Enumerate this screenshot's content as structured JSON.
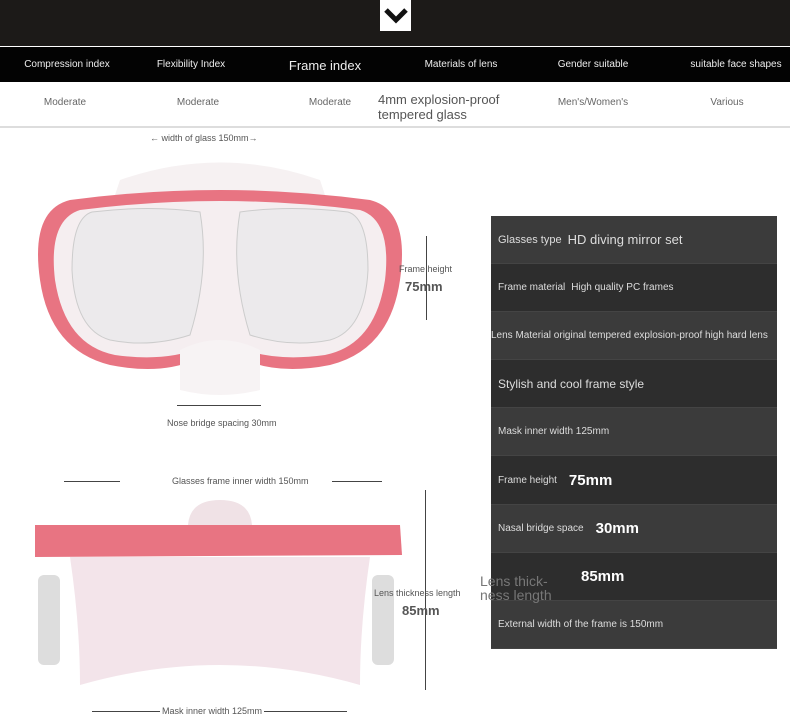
{
  "header": {
    "columns": [
      "Compression index",
      "Flexibility Index",
      "Frame index",
      "Materials of lens",
      "Gender suitable",
      "suitable face shapes"
    ],
    "values": [
      "Moderate",
      "Moderate",
      "Moderate",
      "4mm explosion-proof tempered glass",
      "Men's/Women's",
      "Various"
    ]
  },
  "diagram1": {
    "width_label": "← width of glass 150mm→",
    "height_label": "Frame height",
    "height_value": "75mm",
    "nose_label": "Nose bridge spacing 30mm"
  },
  "diagram2": {
    "width_label": "Glasses frame inner width 150mm",
    "thickness_label": "Lens thickness length",
    "thickness_value": "85mm",
    "inner_label": "Mask inner width 125mm",
    "overlay": "Lens thick-ness length"
  },
  "specs": [
    {
      "label": "Glasses type",
      "value": "HD diving mirror set"
    },
    {
      "label": "Frame material",
      "value": "High quality PC frames"
    },
    {
      "label": "Lens Material original tempered explosion-proof high hard lens",
      "value": ""
    },
    {
      "label": "Stylish and cool frame style",
      "value": ""
    },
    {
      "label": "Mask inner width 125mm",
      "value": ""
    },
    {
      "label": "Frame height",
      "value": "75mm"
    },
    {
      "label": "Nasal bridge space",
      "value": "30mm"
    },
    {
      "label": "",
      "value": "85mm"
    },
    {
      "label": "External width of the frame is 150mm",
      "value": ""
    }
  ],
  "colors": {
    "frame": "#e8707e",
    "panel": "#3b3b3b"
  }
}
